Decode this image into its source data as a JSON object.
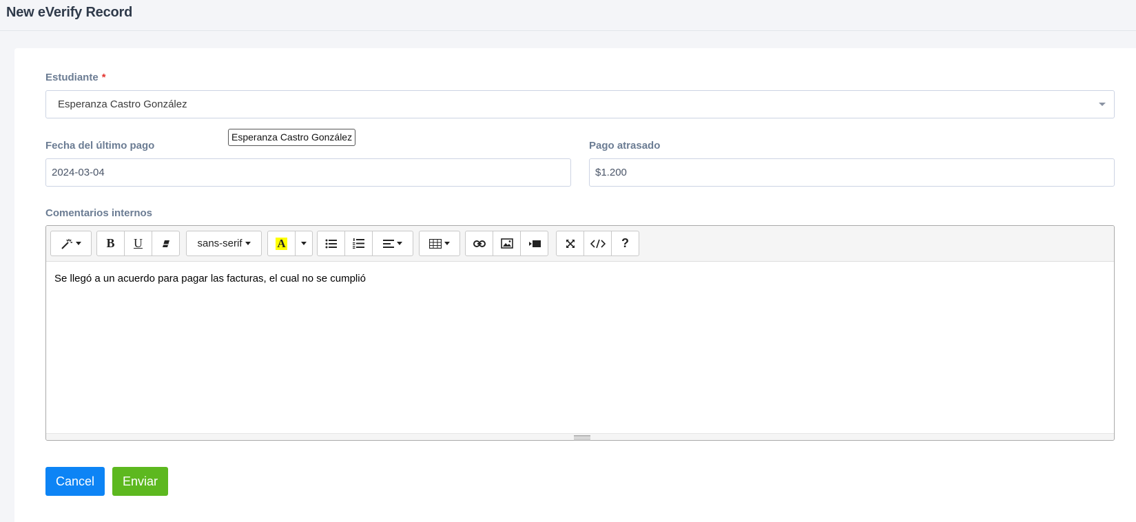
{
  "page": {
    "title": "New eVerify Record"
  },
  "form": {
    "student": {
      "label": "Estudiante",
      "required_mark": "*",
      "value": "Esperanza Castro González",
      "tooltip": "Esperanza Castro González"
    },
    "last_payment": {
      "label": "Fecha del último pago",
      "value": "2024-03-04"
    },
    "overdue": {
      "label": "Pago atrasado",
      "value": "$1.200"
    },
    "comments": {
      "label": "Comentarios internos",
      "content": "Se llegó a un acuerdo para pagar las facturas, el cual no se cumplió"
    }
  },
  "editor": {
    "font_name": "sans-serif",
    "bold_label": "B",
    "underline_label": "U",
    "color_label": "A",
    "help_label": "?",
    "highlight_color": "#ffff00",
    "icons": [
      "magic-icon",
      "eraser-icon",
      "unordered-list-icon",
      "ordered-list-icon",
      "align-icon",
      "table-icon",
      "link-icon",
      "picture-icon",
      "video-icon",
      "fullscreen-icon",
      "code-view-icon"
    ]
  },
  "actions": {
    "cancel_label": "Cancel",
    "submit_label": "Enviar"
  },
  "colors": {
    "primary": "#0d84f5",
    "success": "#5db81f",
    "required": "#e3342f",
    "label": "#6b7c93"
  }
}
